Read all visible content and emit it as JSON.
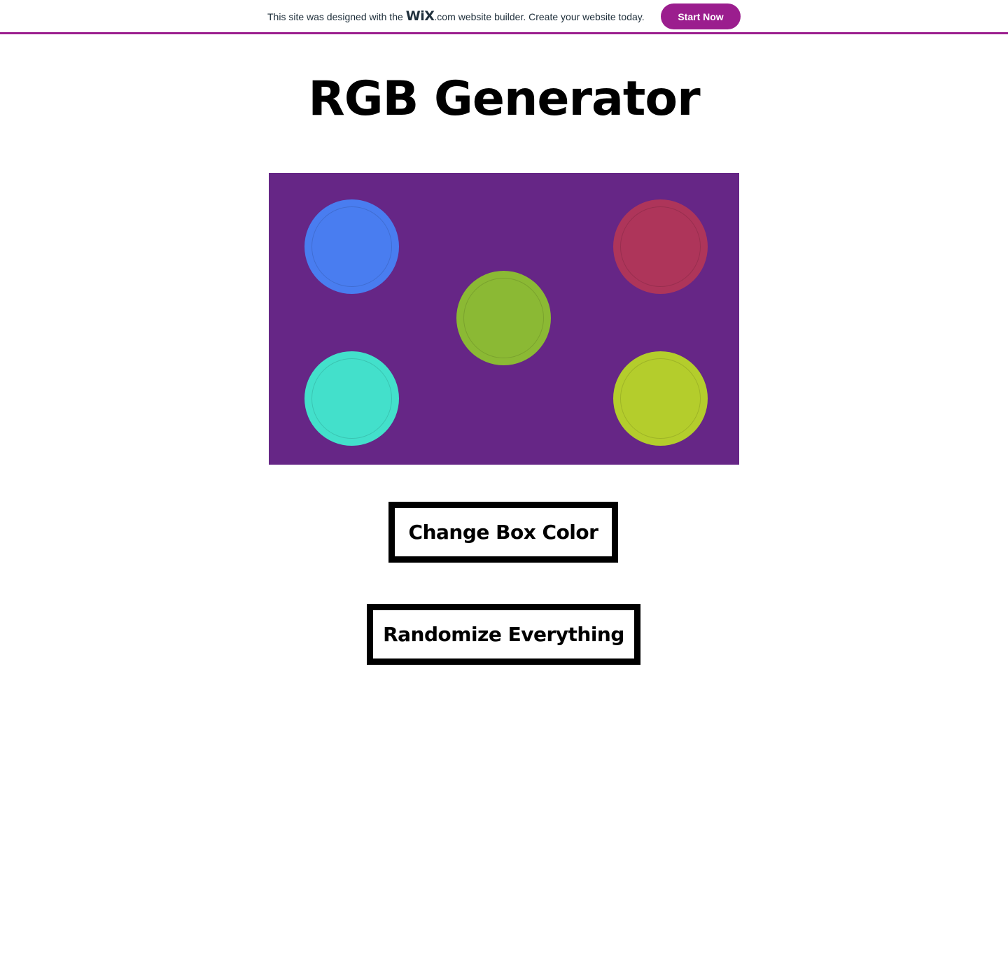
{
  "banner": {
    "text_before": "This site was designed with the",
    "logo": "WiX",
    "logo_suffix": ".com",
    "text_after": "website builder. Create your website today.",
    "button_label": "Start Now",
    "accent_color": "#9b1e8e"
  },
  "page": {
    "title": "RGB Generator"
  },
  "color_box": {
    "background": "#662686",
    "circles": [
      {
        "color": "#497df0"
      },
      {
        "color": "#ae355a"
      },
      {
        "color": "#8bb934"
      },
      {
        "color": "#43e0cb"
      },
      {
        "color": "#b4cd2c"
      }
    ]
  },
  "buttons": {
    "change_box_color": "Change Box Color",
    "randomize_everything": "Randomize Everything"
  }
}
